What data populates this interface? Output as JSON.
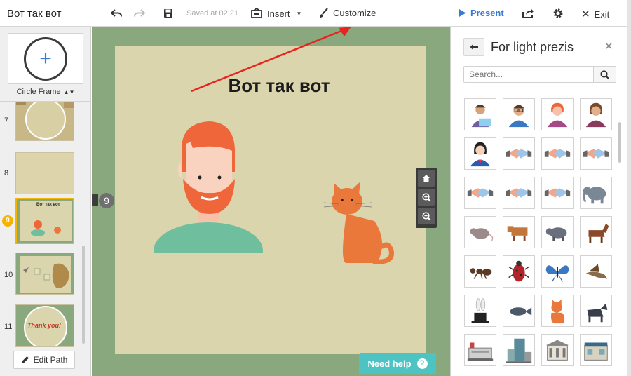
{
  "toolbar": {
    "doc_title": "Вот так вот",
    "saved_status": "Saved at 02:21",
    "insert_label": "Insert",
    "customize_label": "Customize",
    "present_label": "Present",
    "exit_label": "Exit"
  },
  "sidebar": {
    "frame_type": "Circle Frame",
    "thumbnails": [
      {
        "number": "7",
        "text": ""
      },
      {
        "number": "8",
        "text": ""
      },
      {
        "number": "9",
        "text": "Вот так вот",
        "selected": true
      },
      {
        "number": "10",
        "text": ""
      },
      {
        "number": "11",
        "text": "Thank you!"
      }
    ],
    "edit_path_label": "Edit Path"
  },
  "canvas": {
    "slide_title": "Вот так вот",
    "current_frame_number": "9",
    "need_help_label": "Need help",
    "colors": {
      "canvas_bg": "#8aa87e",
      "slide_bg": "#dbd5ad",
      "hair": "#f0663b",
      "shirt": "#6fbf9f",
      "cat": "#e9783a"
    }
  },
  "panel": {
    "title": "For light prezis",
    "search_placeholder": "Search...",
    "tiles": [
      "man-with-laptop-icon",
      "man-with-glasses-icon",
      "woman-orange-hair-icon",
      "woman-brown-hair-icon",
      "woman-superhero-icon",
      "handshake-icon",
      "handshake-icon",
      "handshake-icon",
      "handshake-icon",
      "handshake-icon",
      "handshake-icon",
      "elephant-icon",
      "rat-icon",
      "cow-icon",
      "pig-icon",
      "horse-icon",
      "ant-icon",
      "beetle-icon",
      "butterfly-icon",
      "bird-icon",
      "magic-hat-rabbit-icon",
      "fish-icon",
      "orange-cat-icon",
      "wolf-icon",
      "building-icon",
      "office-tower-icon",
      "museum-icon",
      "shop-icon"
    ]
  }
}
